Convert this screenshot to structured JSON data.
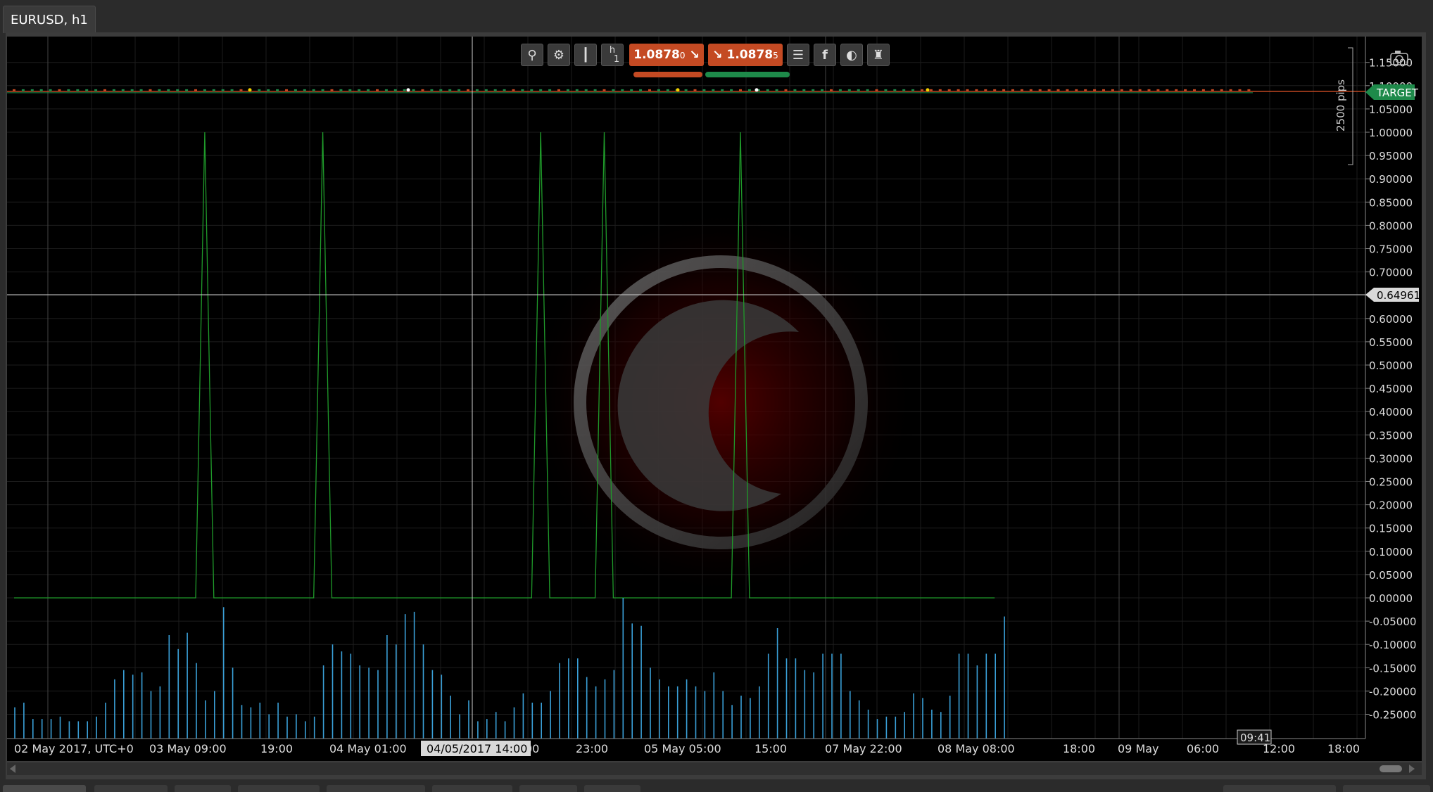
{
  "tab": {
    "title": "EURUSD, h1"
  },
  "toolbar": {
    "period_label": "h",
    "period_sub": "1",
    "sell_price": "1.0878",
    "sell_pip": "0",
    "buy_price": "1.0878",
    "buy_pip": "5",
    "icons": [
      "zoom-icon",
      "chart-settings-icon",
      "candles-icon",
      "period-button",
      "list-icon",
      "facebook-icon",
      "theme-icon",
      "trader-icon"
    ]
  },
  "price_axis": {
    "labels": [
      "1.15000",
      "1.10000",
      "1.05000",
      "1.00000",
      "0.95000",
      "0.90000",
      "0.85000",
      "0.80000",
      "0.75000",
      "0.70000",
      "0.65000",
      "0.60000",
      "0.55000",
      "0.50000",
      "0.45000",
      "0.40000",
      "0.35000",
      "0.30000",
      "0.25000",
      "0.20000",
      "0.15000",
      "0.10000",
      "0.05000",
      "0.00000",
      "-0.05000",
      "-0.10000",
      "-0.15000",
      "-0.20000",
      "-0.25000"
    ],
    "crosshair_value": "0.64961",
    "target_label": "TARGET",
    "pips_label": "2500 pips"
  },
  "time_axis": {
    "labels": [
      "02 May 2017, UTC+0",
      "03 May 09:00",
      "19:00",
      "04 May 01:00",
      "00",
      "23:00",
      "05 May 05:00",
      "15:00",
      "07 May 22:00",
      "08 May 08:00",
      "18:00",
      "09 May",
      "06:00",
      "12:00",
      "18:00"
    ],
    "crosshair_time": "04/05/2017 14:00",
    "current_time": "09:41"
  },
  "colors": {
    "background": "#000000",
    "sell": "#c44a23",
    "buy": "#1e8a4a",
    "spike": "#1f9a2a",
    "histogram": "#3aa0d8",
    "target": "#1e8a4a"
  },
  "chart_data": {
    "type": "line",
    "title": "",
    "ylim": [
      -0.28,
      1.17
    ],
    "series": [
      {
        "name": "",
        "values": [
          0,
          0,
          0,
          0,
          0,
          0,
          0,
          0,
          0,
          0,
          0,
          0,
          0,
          0,
          0,
          0,
          0,
          0,
          0,
          0,
          0,
          1,
          0,
          0,
          0,
          0,
          0,
          0,
          0,
          0,
          0,
          0,
          0,
          0,
          1,
          0,
          0,
          0,
          0,
          0,
          0,
          0,
          0,
          0,
          0,
          0,
          0,
          0,
          0,
          0,
          0,
          0,
          0,
          0,
          0,
          0,
          0,
          0,
          1,
          0,
          0,
          0,
          0,
          0,
          0,
          1,
          0,
          0,
          0,
          0,
          0,
          0,
          0,
          0,
          0,
          0,
          0,
          0,
          0,
          0,
          1,
          0,
          0,
          0,
          0,
          0,
          0,
          0,
          0,
          0,
          0,
          0,
          0,
          0,
          0,
          0,
          0,
          0,
          0,
          0,
          0,
          0,
          0,
          0,
          0,
          0,
          0,
          0,
          0
        ]
      },
      {
        "name": "",
        "values": [
          -0.235,
          -0.225,
          -0.26,
          -0.26,
          -0.26,
          -0.255,
          -0.265,
          -0.265,
          -0.265,
          -0.255,
          -0.225,
          -0.175,
          -0.155,
          -0.165,
          -0.16,
          -0.2,
          -0.19,
          -0.08,
          -0.11,
          -0.075,
          -0.14,
          -0.22,
          -0.2,
          -0.02,
          -0.15,
          -0.23,
          -0.235,
          -0.225,
          -0.25,
          -0.225,
          -0.255,
          -0.25,
          -0.265,
          -0.255,
          -0.145,
          -0.1,
          -0.115,
          -0.12,
          -0.145,
          -0.15,
          -0.155,
          -0.08,
          -0.1,
          -0.035,
          -0.03,
          -0.1,
          -0.155,
          -0.165,
          -0.21,
          -0.25,
          -0.22,
          -0.265,
          -0.26,
          -0.245,
          -0.265,
          -0.235,
          -0.205,
          -0.225,
          -0.225,
          -0.2,
          -0.14,
          -0.13,
          -0.13,
          -0.17,
          -0.19,
          -0.175,
          -0.155,
          0,
          -0.055,
          -0.06,
          -0.15,
          -0.175,
          -0.19,
          -0.19,
          -0.175,
          -0.19,
          -0.2,
          -0.16,
          -0.2,
          -0.23,
          -0.21,
          -0.215,
          -0.19,
          -0.12,
          -0.065,
          -0.13,
          -0.13,
          -0.155,
          -0.16,
          -0.12,
          -0.12,
          -0.12,
          -0.2,
          -0.22,
          -0.24,
          -0.26,
          -0.255,
          -0.255,
          -0.245,
          -0.205,
          -0.215,
          -0.24,
          -0.245,
          -0.21,
          -0.12,
          -0.12,
          -0.145,
          -0.12,
          -0.12,
          -0.04
        ]
      }
    ]
  }
}
